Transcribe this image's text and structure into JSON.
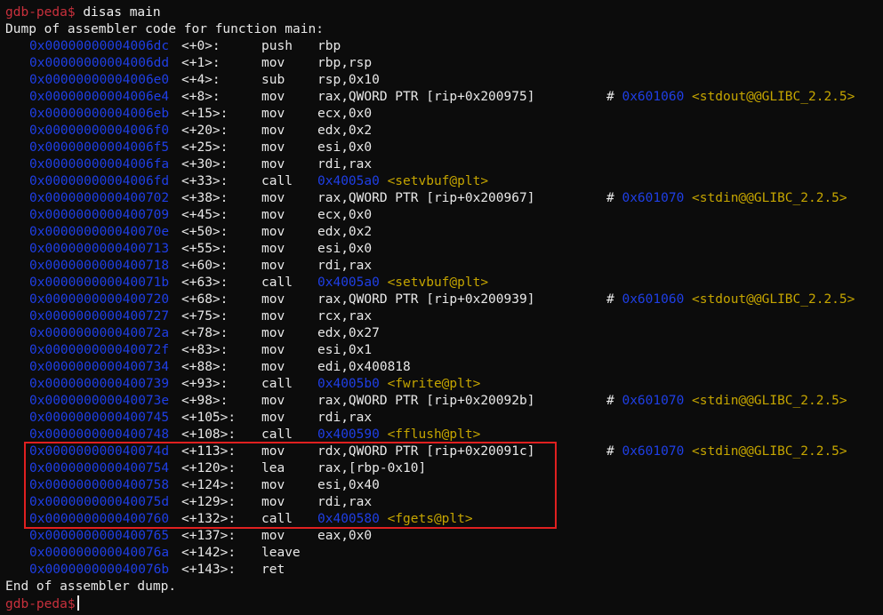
{
  "prompt": "gdb-peda$",
  "command": "disas main",
  "header": "Dump of assembler code for function main:",
  "footer": "End of assembler dump.",
  "instructions": [
    {
      "addr": "0x00000000004006dc",
      "off": "<+0>:",
      "mn": "push",
      "ops": "rbp"
    },
    {
      "addr": "0x00000000004006dd",
      "off": "<+1>:",
      "mn": "mov",
      "ops": "rbp,rsp"
    },
    {
      "addr": "0x00000000004006e0",
      "off": "<+4>:",
      "mn": "sub",
      "ops": "rsp,0x10"
    },
    {
      "addr": "0x00000000004006e4",
      "off": "<+8>:",
      "mn": "mov",
      "ops": "rax,QWORD PTR [rip+0x200975]",
      "hash": "#",
      "caddr": "0x601060",
      "csym": "<stdout@@GLIBC_2.2.5>"
    },
    {
      "addr": "0x00000000004006eb",
      "off": "<+15>:",
      "mn": "mov",
      "ops": "ecx,0x0"
    },
    {
      "addr": "0x00000000004006f0",
      "off": "<+20>:",
      "mn": "mov",
      "ops": "edx,0x2"
    },
    {
      "addr": "0x00000000004006f5",
      "off": "<+25>:",
      "mn": "mov",
      "ops": "esi,0x0"
    },
    {
      "addr": "0x00000000004006fa",
      "off": "<+30>:",
      "mn": "mov",
      "ops": "rdi,rax"
    },
    {
      "addr": "0x00000000004006fd",
      "off": "<+33>:",
      "mn": "call",
      "taddr": "0x4005a0",
      "tsym": "<setvbuf@plt>"
    },
    {
      "addr": "0x0000000000400702",
      "off": "<+38>:",
      "mn": "mov",
      "ops": "rax,QWORD PTR [rip+0x200967]",
      "hash": "#",
      "caddr": "0x601070",
      "csym": "<stdin@@GLIBC_2.2.5>"
    },
    {
      "addr": "0x0000000000400709",
      "off": "<+45>:",
      "mn": "mov",
      "ops": "ecx,0x0"
    },
    {
      "addr": "0x000000000040070e",
      "off": "<+50>:",
      "mn": "mov",
      "ops": "edx,0x2"
    },
    {
      "addr": "0x0000000000400713",
      "off": "<+55>:",
      "mn": "mov",
      "ops": "esi,0x0"
    },
    {
      "addr": "0x0000000000400718",
      "off": "<+60>:",
      "mn": "mov",
      "ops": "rdi,rax"
    },
    {
      "addr": "0x000000000040071b",
      "off": "<+63>:",
      "mn": "call",
      "taddr": "0x4005a0",
      "tsym": "<setvbuf@plt>"
    },
    {
      "addr": "0x0000000000400720",
      "off": "<+68>:",
      "mn": "mov",
      "ops": "rax,QWORD PTR [rip+0x200939]",
      "hash": "#",
      "caddr": "0x601060",
      "csym": "<stdout@@GLIBC_2.2.5>"
    },
    {
      "addr": "0x0000000000400727",
      "off": "<+75>:",
      "mn": "mov",
      "ops": "rcx,rax"
    },
    {
      "addr": "0x000000000040072a",
      "off": "<+78>:",
      "mn": "mov",
      "ops": "edx,0x27"
    },
    {
      "addr": "0x000000000040072f",
      "off": "<+83>:",
      "mn": "mov",
      "ops": "esi,0x1"
    },
    {
      "addr": "0x0000000000400734",
      "off": "<+88>:",
      "mn": "mov",
      "ops": "edi,0x400818"
    },
    {
      "addr": "0x0000000000400739",
      "off": "<+93>:",
      "mn": "call",
      "taddr": "0x4005b0",
      "tsym": "<fwrite@plt>"
    },
    {
      "addr": "0x000000000040073e",
      "off": "<+98>:",
      "mn": "mov",
      "ops": "rax,QWORD PTR [rip+0x20092b]",
      "hash": "#",
      "caddr": "0x601070",
      "csym": "<stdin@@GLIBC_2.2.5>"
    },
    {
      "addr": "0x0000000000400745",
      "off": "<+105>:",
      "mn": "mov",
      "ops": "rdi,rax"
    },
    {
      "addr": "0x0000000000400748",
      "off": "<+108>:",
      "mn": "call",
      "taddr": "0x400590",
      "tsym": "<fflush@plt>"
    },
    {
      "addr": "0x000000000040074d",
      "off": "<+113>:",
      "mn": "mov",
      "ops": "rdx,QWORD PTR [rip+0x20091c]",
      "hash": "#",
      "caddr": "0x601070",
      "csym": "<stdin@@GLIBC_2.2.5>"
    },
    {
      "addr": "0x0000000000400754",
      "off": "<+120>:",
      "mn": "lea",
      "ops": "rax,[rbp-0x10]"
    },
    {
      "addr": "0x0000000000400758",
      "off": "<+124>:",
      "mn": "mov",
      "ops": "esi,0x40"
    },
    {
      "addr": "0x000000000040075d",
      "off": "<+129>:",
      "mn": "mov",
      "ops": "rdi,rax"
    },
    {
      "addr": "0x0000000000400760",
      "off": "<+132>:",
      "mn": "call",
      "taddr": "0x400580",
      "tsym": "<fgets@plt>"
    },
    {
      "addr": "0x0000000000400765",
      "off": "<+137>:",
      "mn": "mov",
      "ops": "eax,0x0"
    },
    {
      "addr": "0x000000000040076a",
      "off": "<+142>:",
      "mn": "leave"
    },
    {
      "addr": "0x000000000040076b",
      "off": "<+143>:",
      "mn": "ret"
    }
  ],
  "colors": {
    "background": "#0c0c0c",
    "prompt": "#c8303c",
    "address": "#1f3fe6",
    "symbol": "#c5a500",
    "highlight_box": "#e02020"
  }
}
